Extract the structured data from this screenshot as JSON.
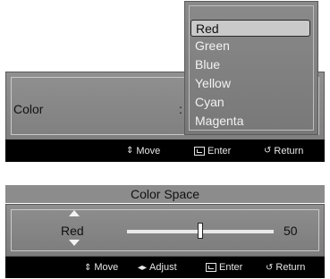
{
  "menu1": {
    "row_label": "Color",
    "row_colon": ":",
    "guide": {
      "move_icon": "up-down-icon",
      "move": "Move",
      "enter": "Enter",
      "return": "Return"
    }
  },
  "dropdown": {
    "selected": "Red",
    "options": [
      "Red",
      "Green",
      "Blue",
      "Yellow",
      "Cyan",
      "Magenta"
    ]
  },
  "menu2": {
    "title": "Color Space",
    "channel": "Red",
    "value": "50",
    "level": 0.5,
    "guide": {
      "move": "Move",
      "adjust": "Adjust",
      "enter": "Enter",
      "return": "Return"
    }
  },
  "colors": {
    "panel": "#858585",
    "guide_bar": "#000000",
    "highlight": "#c9c9c9"
  }
}
